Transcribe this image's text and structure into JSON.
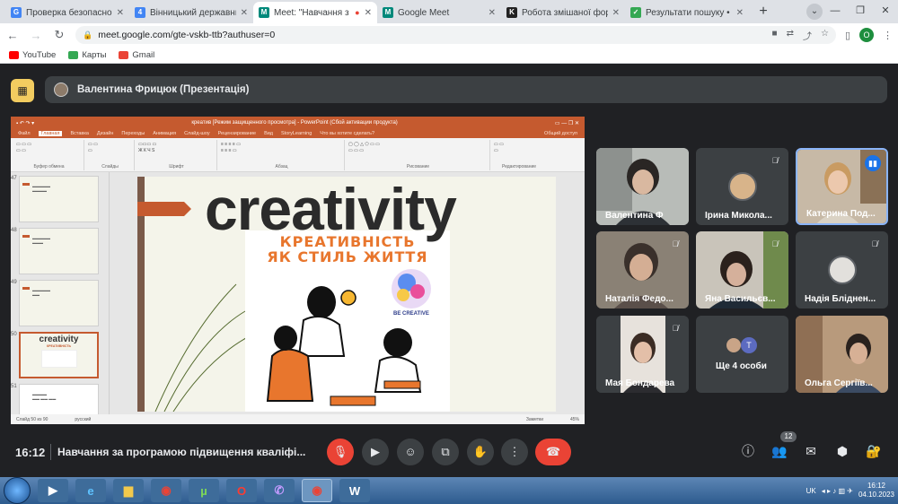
{
  "browser": {
    "tabs": [
      {
        "title": "Проверка безопаснос",
        "fav_color": "#4285f4",
        "fav_letter": "G",
        "active": false
      },
      {
        "title": "Вінницький державни",
        "fav_color": "#4285f4",
        "fav_letter": "4",
        "active": false
      },
      {
        "title": "Meet: \"Навчання з",
        "fav_color": "#00897b",
        "fav_letter": "M",
        "active": true
      },
      {
        "title": "Google Meet",
        "fav_color": "#00897b",
        "fav_letter": "M",
        "active": false
      },
      {
        "title": "Робота змішаної форм",
        "fav_color": "#222222",
        "fav_letter": "K",
        "active": false
      },
      {
        "title": "Результати пошуку • m",
        "fav_color": "#34a853",
        "fav_letter": "✓",
        "active": false
      }
    ],
    "url": "meet.google.com/gte-vskb-ttb?authuser=0",
    "profile_letter": "O",
    "bookmarks": [
      {
        "label": "YouTube",
        "color": "#ff0000"
      },
      {
        "label": "Карты",
        "color": "#34a853"
      },
      {
        "label": "Gmail",
        "color": "#ea4335"
      }
    ]
  },
  "meet": {
    "presenter_label": "Валентина Фрицюк (Презентація)",
    "time": "16:12",
    "meeting_title": "Навчання за програмою підвищення кваліфі...",
    "participants_count": "12",
    "participants": [
      {
        "name": "Валентина Ф",
        "muted": false,
        "speaking": false,
        "bg": "#9aa3a3"
      },
      {
        "name": "Ірина Микола...",
        "muted": true,
        "speaking": false,
        "bg": "#3c4043"
      },
      {
        "name": "Катерина Под...",
        "muted": false,
        "speaking": true,
        "bg": "#b7a48e"
      },
      {
        "name": "Наталія Федо...",
        "muted": true,
        "speaking": false,
        "bg": "#8e8273"
      },
      {
        "name": "Яна Васильєв...",
        "muted": true,
        "speaking": false,
        "bg": "#a8a39a"
      },
      {
        "name": "Надія Бліднен...",
        "muted": true,
        "speaking": false,
        "bg": "#3c4043"
      },
      {
        "name": "Мая Бондарева",
        "muted": true,
        "speaking": false,
        "bg": "#c9c2bb"
      },
      {
        "name": "Ще 4 особи",
        "muted": false,
        "speaking": false,
        "bg": "#3c4043"
      },
      {
        "name": "Ольга Сергіїв...",
        "muted": false,
        "speaking": false,
        "bg": "#b89a7c"
      }
    ]
  },
  "powerpoint": {
    "window_title": "креатив [Режим защищенного просмотра] - PowerPoint (Сбой активации продукта)",
    "menu": [
      "Файл",
      "Главная",
      "Вставка",
      "Дизайн",
      "Переходы",
      "Анимация",
      "Слайд-шоу",
      "Рецензирование",
      "Вид",
      "StoryLearning",
      "Что вы хотите сделать?"
    ],
    "selected_menu": "Главная",
    "share_label": "Общий доступ",
    "ribbon_groups": [
      "Буфер обмена",
      "Слайды",
      "Шрифт",
      "Абзац",
      "Рисование",
      "Редактирование"
    ],
    "thumb_numbers": [
      "47",
      "48",
      "49",
      "50",
      "51"
    ],
    "status_left": "Слайд 50 из 90",
    "status_lang": "русский",
    "status_notes": "Заметки",
    "status_zoom": "45%",
    "slide": {
      "title": "creativity",
      "subtitle_line1": "КРЕАТИВНІСТЬ",
      "subtitle_line2": "ЯК СТИЛЬ ЖИТТЯ",
      "badge": "BE CREATIVE"
    }
  },
  "taskbar": {
    "lang": "UK",
    "time": "16:12",
    "date": "04.10.2023"
  },
  "colors": {
    "accent": "#c55a2f",
    "meet_bg": "#202124",
    "end_call": "#ea4335",
    "mute_red": "#ea4335"
  }
}
